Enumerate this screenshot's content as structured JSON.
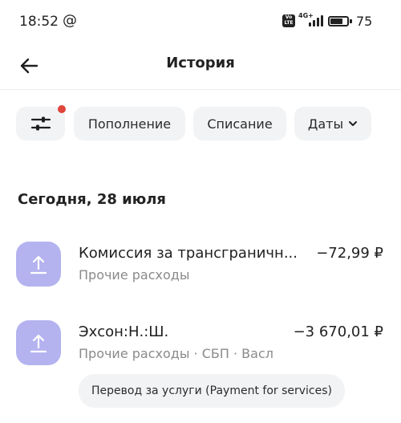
{
  "status_bar": {
    "time": "18:52",
    "at_symbol": "@",
    "volte_label": "Vo\nLTE",
    "network_label": "4G+",
    "battery_percent_text": "75",
    "battery_level_percent": 75
  },
  "header": {
    "back_icon": "arrow-left-icon",
    "title": "История"
  },
  "filters": {
    "settings_icon": "sliders-icon",
    "settings_has_notification": true,
    "topup_label": "Пополнение",
    "debit_label": "Списание",
    "dates_label": "Даты",
    "dates_icon": "chevron-down-icon"
  },
  "section": {
    "date_heading": "Сегодня, 28 июля"
  },
  "transactions": [
    {
      "icon": "upload-arrow-icon",
      "title": "Комиссия за трансграничн...",
      "subtitle": "Прочие расходы",
      "amount": "−72,99 ₽"
    },
    {
      "icon": "upload-arrow-icon",
      "title": "Эхсон:Н.:Ш.",
      "subtitle": "Прочие расходы · СБП · Васл",
      "amount": "−3 670,01 ₽",
      "purpose": "Перевод за услуги (Payment for services)"
    }
  ],
  "colors": {
    "icon_tile": "#b4b3f0",
    "chip_bg": "#f2f3f5",
    "notification_dot": "#e0453c",
    "subtitle_text": "#8a8a8a"
  }
}
